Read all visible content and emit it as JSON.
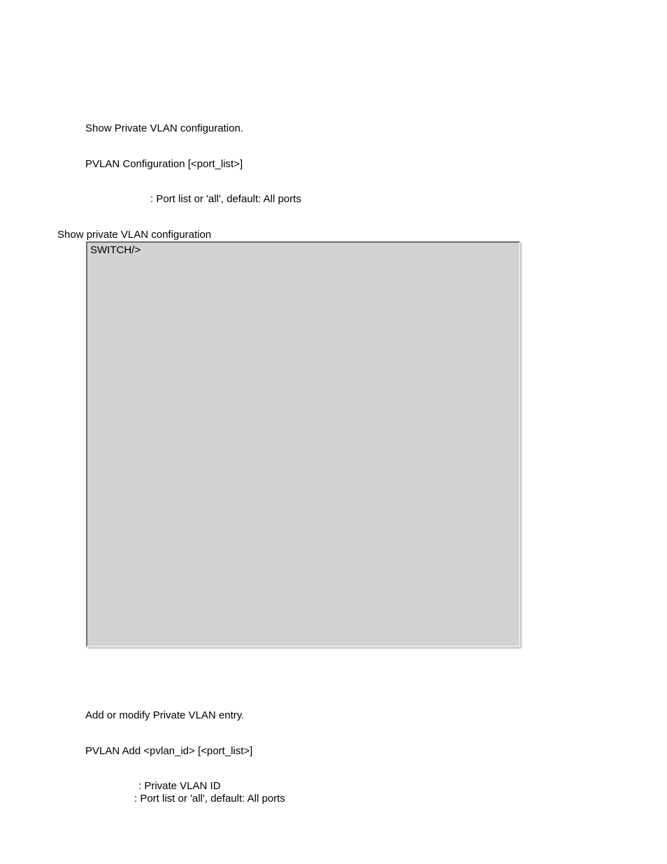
{
  "section1": {
    "desc": "Show Private VLAN configuration.",
    "syntax": "PVLAN Configuration [<port_list>]",
    "param_desc": ": Port list or 'all', default: All ports",
    "example_title": "Show private VLAN configuration",
    "prompt": "SWITCH/>"
  },
  "section2": {
    "desc": "Add or modify Private VLAN entry.",
    "syntax": "PVLAN Add <pvlan_id> [<port_list>]",
    "param1_desc": ": Private VLAN ID",
    "param2_desc": ": Port list or 'all', default: All ports"
  }
}
